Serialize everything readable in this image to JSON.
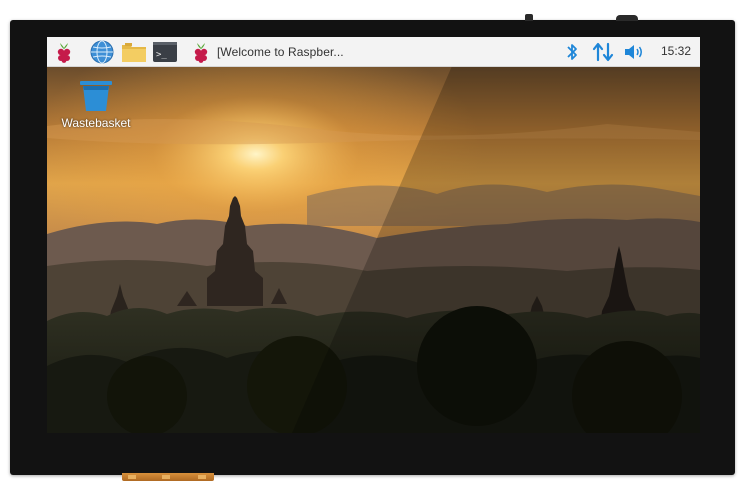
{
  "taskbar": {
    "launchers": [
      {
        "name": "raspberry-menu",
        "icon": "raspberry-icon"
      },
      {
        "name": "web-browser",
        "icon": "globe-icon"
      },
      {
        "name": "file-manager",
        "icon": "folder-icon"
      },
      {
        "name": "terminal",
        "icon": "terminal-icon",
        "prompt": ">_"
      }
    ],
    "window_button": {
      "icon": "raspberry-icon",
      "title": "[Welcome to Raspber..."
    },
    "tray": {
      "bluetooth_icon": "bluetooth-icon",
      "network_icon": "network-transfer-icon",
      "volume_icon": "volume-icon"
    },
    "clock": "15:32"
  },
  "desktop": {
    "icons": [
      {
        "label": "Wastebasket",
        "icon": "trash-icon"
      }
    ]
  },
  "colors": {
    "taskbar_bg": "#f3f3f3",
    "tray_accent": "#1e86d8",
    "device_bezel": "#121212",
    "wastebasket_blue": "#2c8ed6"
  }
}
